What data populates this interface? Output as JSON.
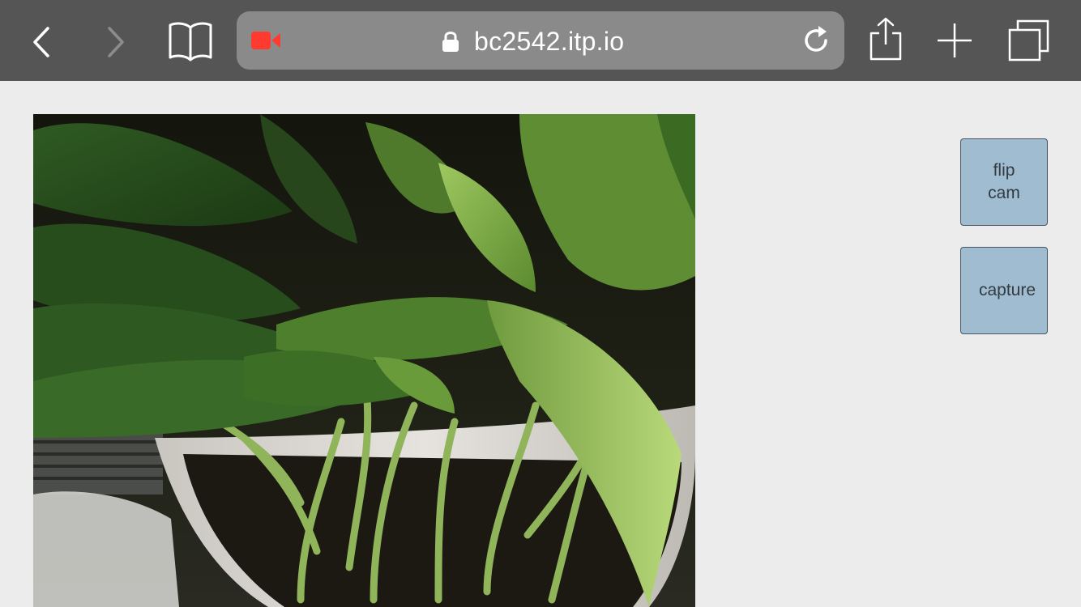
{
  "browser": {
    "url": "bc2542.itp.io",
    "icons": {
      "back": "back-chevron-icon",
      "forward": "forward-chevron-icon",
      "bookmarks": "book-icon",
      "recording": "video-camera-icon",
      "lock": "lock-icon",
      "reload": "reload-icon",
      "share": "share-icon",
      "new_tab": "plus-icon",
      "tabs": "tabs-icon"
    },
    "colors": {
      "toolbar": "#555555",
      "url_bar": "#8a8a8a",
      "recording_indicator": "#ff3b30",
      "forward_disabled": "#8c8c8c"
    }
  },
  "page": {
    "buttons": {
      "flip_cam": "flip cam",
      "capture": "capture"
    },
    "colors": {
      "background": "#ececec",
      "button": "#9fbcd0"
    }
  }
}
